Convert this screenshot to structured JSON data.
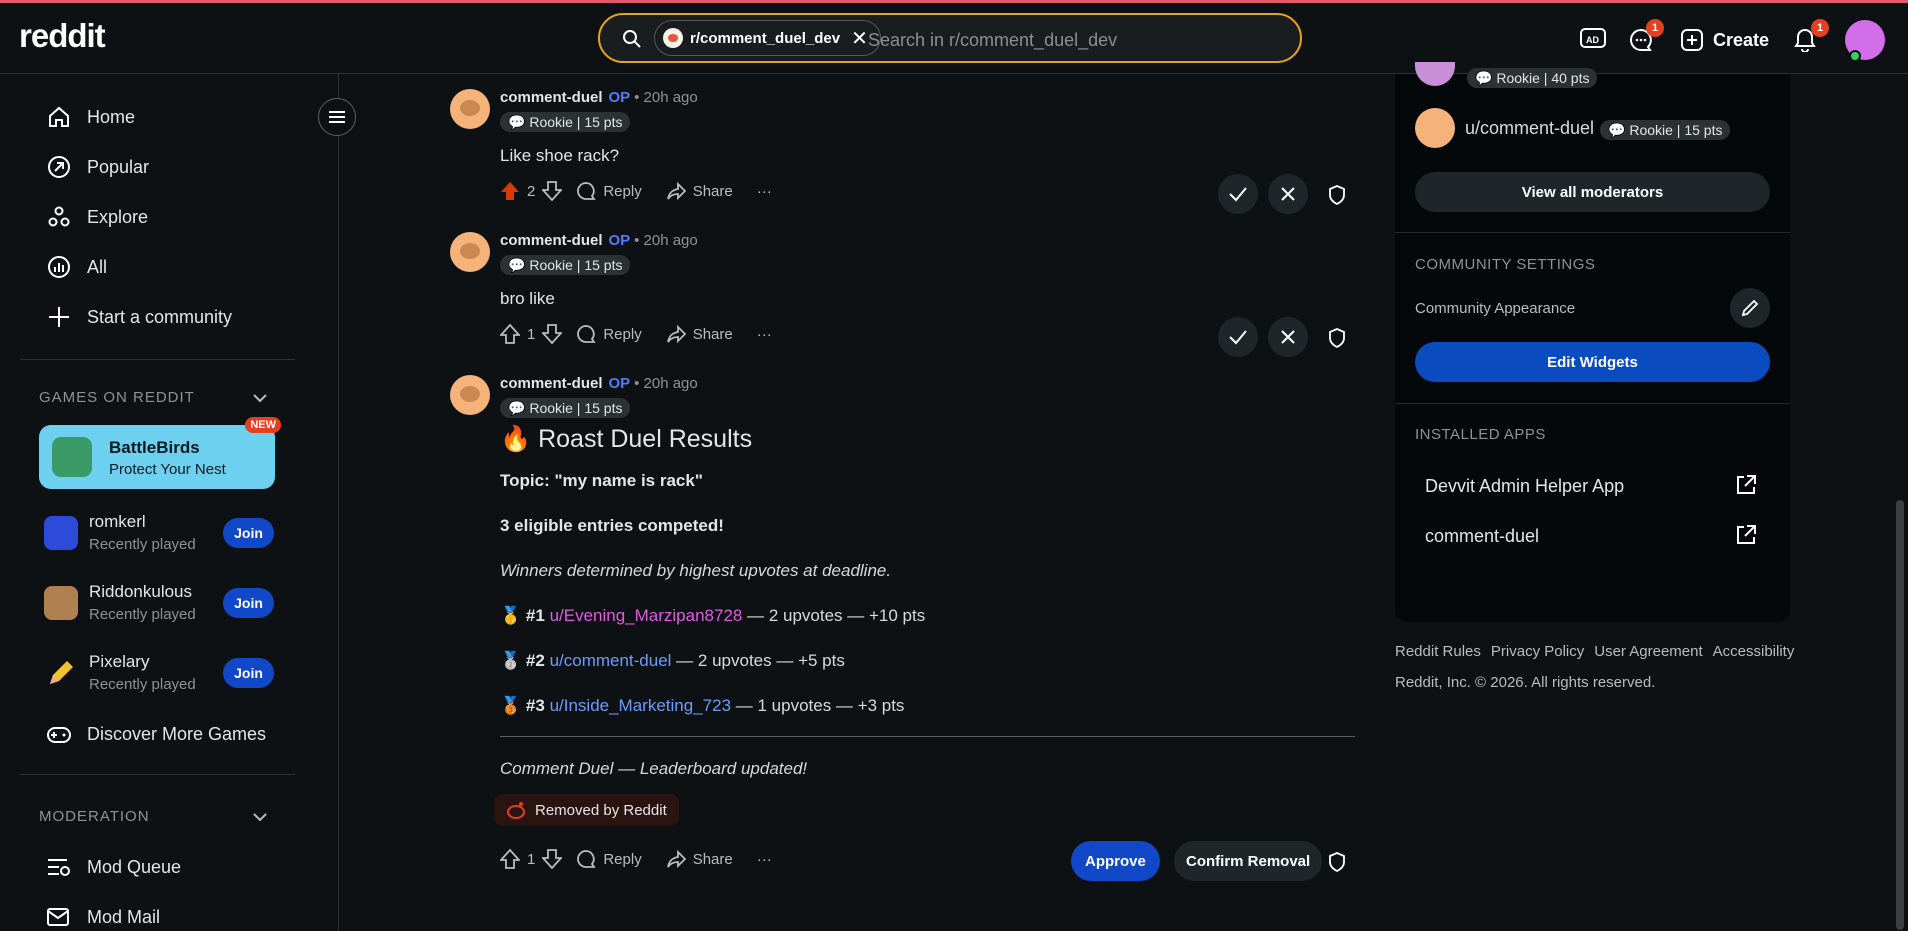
{
  "header": {
    "logo": "reddit",
    "search_chip": "r/comment_duel_dev",
    "search_placeholder": "Search in r/comment_duel_dev",
    "chat_badge": "1",
    "notif_badge": "1",
    "create_label": "Create"
  },
  "sidebar": {
    "nav": [
      {
        "label": "Home",
        "icon": "home-icon"
      },
      {
        "label": "Popular",
        "icon": "popular-icon"
      },
      {
        "label": "Explore",
        "icon": "explore-icon"
      },
      {
        "label": "All",
        "icon": "all-icon"
      },
      {
        "label": "Start a community",
        "icon": "plus-icon"
      }
    ],
    "games_title": "GAMES ON REDDIT",
    "featured": {
      "name": "BattleBirds",
      "tagline": "Protect Your Nest",
      "badge": "NEW"
    },
    "games": [
      {
        "name": "romkerl",
        "sub": "Recently played",
        "button": "Join"
      },
      {
        "name": "Riddonkulous",
        "sub": "Recently played",
        "button": "Join"
      },
      {
        "name": "Pixelary",
        "sub": "Recently played",
        "button": "Join"
      }
    ],
    "discover": "Discover More Games",
    "moderation_title": "MODERATION",
    "mod_items": [
      {
        "label": "Mod Queue"
      },
      {
        "label": "Mod Mail"
      }
    ]
  },
  "comments": [
    {
      "author": "comment-duel",
      "op": "OP",
      "time": "• 20h ago",
      "flair": "Rookie | 15 pts",
      "text": "Like shoe rack?",
      "votes": "2",
      "reply": "Reply",
      "share": "Share"
    },
    {
      "author": "comment-duel",
      "op": "OP",
      "time": "• 20h ago",
      "flair": "Rookie | 15 pts",
      "text": "bro like",
      "votes": "1",
      "reply": "Reply",
      "share": "Share"
    },
    {
      "author": "comment-duel",
      "op": "OP",
      "time": "• 20h ago",
      "flair": "Rookie | 15 pts",
      "votes": "1",
      "reply": "Reply",
      "share": "Share"
    }
  ],
  "results": {
    "title": "Roast Duel Results",
    "topic": "Topic: \"my name is rack\"",
    "entries": "3 eligible entries competed!",
    "note": "Winners determined by highest upvotes at deadline.",
    "ranks": [
      {
        "place": "#1",
        "user": "u/Evening_Marzipan8728",
        "detail": " — 2 upvotes — +10 pts",
        "color": "#e05ce0"
      },
      {
        "place": "#2",
        "user": "u/comment-duel",
        "detail": " — 2 upvotes — +5 pts",
        "color": "#6a9cff"
      },
      {
        "place": "#3",
        "user": "u/Inside_Marketing_723",
        "detail": " — 1 upvotes — +3 pts",
        "color": "#6a9cff"
      }
    ],
    "footer": "Comment Duel — Leaderboard updated!",
    "removed_label": "Removed by Reddit",
    "approve": "Approve",
    "confirm": "Confirm Removal"
  },
  "rightbar": {
    "mod_flair_top": "Rookie | 40 pts",
    "mod_user": "u/comment-duel",
    "mod_user_flair": "Rookie | 15 pts",
    "view_all": "View all moderators",
    "settings_title": "COMMUNITY SETTINGS",
    "appearance": "Community Appearance",
    "edit_widgets": "Edit Widgets",
    "installed_title": "INSTALLED APPS",
    "apps": [
      "Devvit Admin Helper App",
      "comment-duel"
    ]
  },
  "footer": {
    "links": [
      "Reddit Rules",
      "Privacy Policy",
      "User Agreement",
      "Accessibility"
    ],
    "copyright": "Reddit, Inc. © 2026. All rights reserved."
  }
}
